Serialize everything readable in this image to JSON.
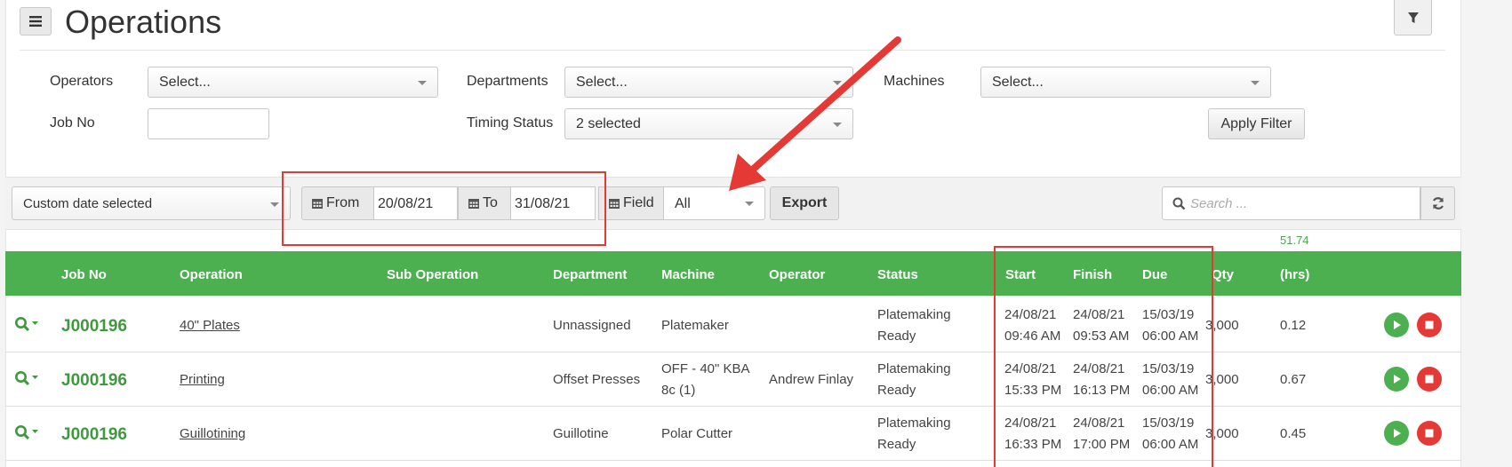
{
  "header": {
    "title": "Operations",
    "menu_icon": "hamburger-icon",
    "filter_icon": "funnel-icon"
  },
  "filters": {
    "operators": {
      "label": "Operators",
      "placeholder": "Select..."
    },
    "departments": {
      "label": "Departments",
      "placeholder": "Select..."
    },
    "machines": {
      "label": "Machines",
      "placeholder": "Select..."
    },
    "job_no": {
      "label": "Job No",
      "value": ""
    },
    "timing_status": {
      "label": "Timing Status",
      "value": "2 selected"
    },
    "apply_label": "Apply Filter"
  },
  "toolbar": {
    "date_preset": "Custom date selected",
    "from_label": "From",
    "from_value": "20/08/21",
    "to_label": "To",
    "to_value": "31/08/21",
    "field_label": "Field",
    "field_value": "All",
    "export_label": "Export",
    "search_placeholder": "Search ..."
  },
  "total_hrs": "51.74",
  "columns": {
    "job_no": "Job No",
    "operation": "Operation",
    "sub_operation": "Sub Operation",
    "department": "Department",
    "machine": "Machine",
    "operator": "Operator",
    "status": "Status",
    "start": "Start",
    "finish": "Finish",
    "due": "Due",
    "qty": "Qty",
    "hrs": "(hrs)"
  },
  "rows": [
    {
      "job_no": "J000196",
      "operation": "40\" Plates",
      "sub_operation": "",
      "department": "Unnassigned",
      "machine_l1": "Platemaker",
      "machine_l2": "",
      "operator": "",
      "status_l1": "Platemaking",
      "status_l2": "Ready",
      "start_date": "24/08/21",
      "start_time": "09:46 AM",
      "finish_date": "24/08/21",
      "finish_time": "09:53 AM",
      "due_date": "15/03/19",
      "due_time": "06:00 AM",
      "qty": "3,000",
      "hrs": "0.12"
    },
    {
      "job_no": "J000196",
      "operation": "Printing",
      "sub_operation": "",
      "department": "Offset Presses",
      "machine_l1": "OFF - 40\" KBA",
      "machine_l2": "8c (1)",
      "operator": "Andrew Finlay",
      "status_l1": "Platemaking",
      "status_l2": "Ready",
      "start_date": "24/08/21",
      "start_time": "15:33 PM",
      "finish_date": "24/08/21",
      "finish_time": "16:13 PM",
      "due_date": "15/03/19",
      "due_time": "06:00 AM",
      "qty": "3,000",
      "hrs": "0.67"
    },
    {
      "job_no": "J000196",
      "operation": "Guillotining",
      "sub_operation": "",
      "department": "Guillotine",
      "machine_l1": "Polar Cutter",
      "machine_l2": "",
      "operator": "",
      "status_l1": "Platemaking",
      "status_l2": "Ready",
      "start_date": "24/08/21",
      "start_time": "16:33 PM",
      "finish_date": "24/08/21",
      "finish_time": "17:00 PM",
      "due_date": "15/03/19",
      "due_time": "06:00 AM",
      "qty": "3,000",
      "hrs": "0.45"
    }
  ],
  "annotation_colors": {
    "highlight": "#e53935",
    "header_green": "#4caf50"
  }
}
